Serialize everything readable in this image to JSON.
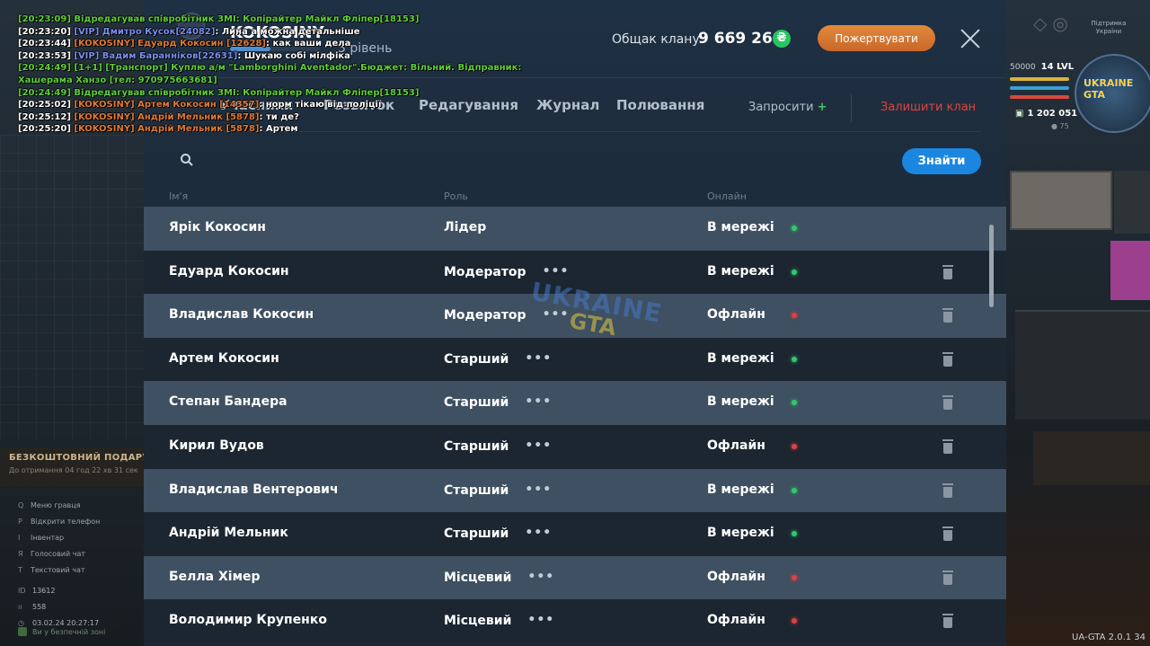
{
  "clan": {
    "name": "KOKOSINY",
    "level_label": "3 рівень",
    "level_progress": 0.45,
    "balance_label": "Общак клану:",
    "balance_value": "9 669 260",
    "coin_symbol": "₴",
    "donate_label": "Пожертвувати"
  },
  "tabs": [
    {
      "label": "Учасники"
    },
    {
      "label": "Розвиток"
    },
    {
      "label": "Редагування"
    },
    {
      "label": "Журнал"
    },
    {
      "label": "Полювання"
    }
  ],
  "actions": {
    "invite_label": "Запросити",
    "invite_plus": "+",
    "leave_label": "Залишити клан"
  },
  "search": {
    "placeholder": "",
    "value": "",
    "button_label": "Знайти"
  },
  "columns": {
    "name": "Ім'я",
    "role": "Роль",
    "online": "Онлайн"
  },
  "members": [
    {
      "name": "Ярік Кокосин",
      "role": "Лідер",
      "status": "В мережі",
      "online": true,
      "more": false,
      "deletable": false
    },
    {
      "name": "Едуард Кокосин",
      "role": "Модератор",
      "status": "В мережі",
      "online": true,
      "more": true,
      "deletable": true
    },
    {
      "name": "Владислав Кокосин",
      "role": "Модератор",
      "status": "Офлайн",
      "online": false,
      "more": true,
      "deletable": true
    },
    {
      "name": "Артем Кокосин",
      "role": "Старший",
      "status": "В мережі",
      "online": true,
      "more": true,
      "deletable": true
    },
    {
      "name": "Степан Бандера",
      "role": "Старший",
      "status": "В мережі",
      "online": true,
      "more": true,
      "deletable": true
    },
    {
      "name": "Кирил Вудов",
      "role": "Старший",
      "status": "Офлайн",
      "online": false,
      "more": true,
      "deletable": true
    },
    {
      "name": "Владислав Вентерович",
      "role": "Старший",
      "status": "В мережі",
      "online": true,
      "more": true,
      "deletable": true
    },
    {
      "name": "Андрій Мельник",
      "role": "Старший",
      "status": "В мережі",
      "online": true,
      "more": true,
      "deletable": true
    },
    {
      "name": "Белла Хімер",
      "role": "Місцевий",
      "status": "Офлайн",
      "online": false,
      "more": true,
      "deletable": true
    },
    {
      "name": "Володимир Крупенко",
      "role": "Місцевий",
      "status": "Офлайн",
      "online": false,
      "more": true,
      "deletable": true
    }
  ],
  "more_glyph": "•••",
  "watermark": {
    "line1": "UKRAINE",
    "line2": "GTA"
  },
  "chat": [
    {
      "parts": [
        {
          "t": "[20:23:09] Відредагував співробітник ЗМІ: Копірайтер Майкл Фліпер[18153]",
          "c": "green"
        }
      ]
    },
    {
      "parts": [
        {
          "t": "[20:23:20] ",
          "c": "white"
        },
        {
          "t": "[VIP] Дмитро Кусок[24082]",
          "c": "blue"
        },
        {
          "t": ": Лина а можна детальніше",
          "c": "white"
        }
      ]
    },
    {
      "parts": [
        {
          "t": "[20:23:44] ",
          "c": "white"
        },
        {
          "t": "[KOKOSINY] Едуард Кокосин [12628]",
          "c": "orange"
        },
        {
          "t": ": как ваши дела",
          "c": "white"
        }
      ]
    },
    {
      "parts": [
        {
          "t": "[20:23:53] ",
          "c": "white"
        },
        {
          "t": "[VIP] Вадим Баранніков[22631]",
          "c": "blue"
        },
        {
          "t": ": Шукаю собі мілфіка",
          "c": "white"
        }
      ]
    },
    {
      "parts": [
        {
          "t": "[20:24:49] [1+1] [Транспорт] Куплю а/м \"Lamborghini Aventador\".Бюджет: Вільний. Відправник:",
          "c": "green"
        }
      ]
    },
    {
      "parts": [
        {
          "t": "Хашерама Ханзо [тел: 970975663681]",
          "c": "green"
        }
      ]
    },
    {
      "parts": [
        {
          "t": "[20:24:49] Відредагував співробітник ЗМІ: Копірайтер Майкл Фліпер[18153]",
          "c": "green"
        }
      ]
    },
    {
      "parts": [
        {
          "t": "[20:25:02] ",
          "c": "white"
        },
        {
          "t": "[KOKOSINY] Артем Кокосин [14357]",
          "c": "orange"
        },
        {
          "t": ": норм тікаю від поліції",
          "c": "white"
        }
      ]
    },
    {
      "parts": [
        {
          "t": "[20:25:12] ",
          "c": "white"
        },
        {
          "t": "[KOKOSINY] Андрій Мельник [5878]",
          "c": "orange"
        },
        {
          "t": ": ти де?",
          "c": "white"
        }
      ]
    },
    {
      "parts": [
        {
          "t": "[20:25:20] ",
          "c": "white"
        },
        {
          "t": "[KOKOSINY] Андрій Мельник [5878]",
          "c": "orange"
        },
        {
          "t": ": Артем",
          "c": "white"
        }
      ]
    }
  ],
  "hud": {
    "gift_title": "БЕЗКОШТОВНИЙ ПОДАРУНОК",
    "gift_sub": "До отримання 04 год 22 хв 31 сек",
    "hints": [
      {
        "key": "Q",
        "label": "Меню гравця"
      },
      {
        "key": "P",
        "label": "Відкрити телефон"
      },
      {
        "key": "I",
        "label": "Інвентар"
      },
      {
        "key": "Я",
        "label": "Голосовий чат"
      },
      {
        "key": "T",
        "label": "Текстовий чат"
      }
    ],
    "id_value": "13612",
    "players_value": "558",
    "datetime": "03.02.24 20:27:17",
    "safe_zone": "Ви у безпечній зоні",
    "xp_value": "50000",
    "level_label": "14 LVL",
    "money": "1 202 051",
    "sub_value": "75",
    "top_tag": "Підтримка України",
    "minimap_logo": "UKRAINE GTA",
    "version": "UA-GTA 2.0.1 34"
  },
  "colors": {
    "accent_blue": "#1a86e0",
    "donate_orange": "#d7773a",
    "online_green": "#2ecb6a",
    "offline_red": "#e04040",
    "leave_red": "#d9463e"
  }
}
